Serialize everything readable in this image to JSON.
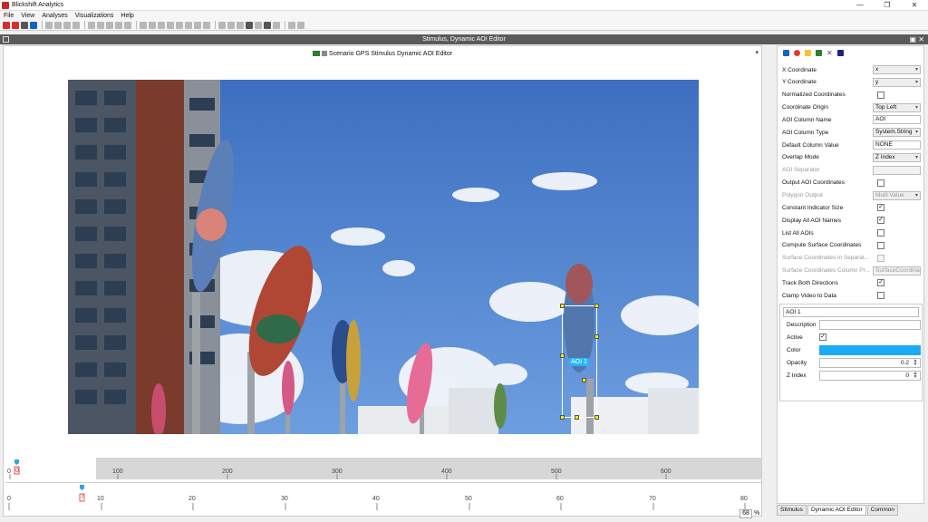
{
  "window": {
    "title": "Blickshift Analytics",
    "controls": [
      "—",
      "❐",
      "✕"
    ]
  },
  "menu": [
    "File",
    "View",
    "Analyses",
    "Visualizations",
    "Help"
  ],
  "panel": {
    "title": "Stimulus, Dynamic AOI Editor"
  },
  "stimulus": {
    "header": "Scenario GPS Stimulus Dynamic AOI Editor",
    "aoi_label": "AOI 1"
  },
  "timeline": {
    "top_ticks": [
      "0",
      "100",
      "200",
      "300",
      "400",
      "500",
      "600"
    ],
    "bottom_ticks": [
      "0",
      "10",
      "20",
      "30",
      "40",
      "50",
      "60",
      "70",
      "80"
    ],
    "top_marker": "0",
    "bottom_marker": "7"
  },
  "zoom": {
    "value": "68",
    "unit": "%"
  },
  "properties": [
    {
      "label": "X Coordinate",
      "type": "select",
      "value": "x"
    },
    {
      "label": "Y Coordinate",
      "type": "select",
      "value": "y"
    },
    {
      "label": "Normalized Coordinates",
      "type": "check",
      "checked": false
    },
    {
      "label": "Coordinate Origin",
      "type": "select",
      "value": "Top Left"
    },
    {
      "label": "AOI Column Name",
      "type": "text",
      "value": "AOI"
    },
    {
      "label": "AOI Column Type",
      "type": "select",
      "value": "System.String"
    },
    {
      "label": "Default Column Value",
      "type": "text",
      "value": "NONE"
    },
    {
      "label": "Overlap Mode",
      "type": "select",
      "value": "Z Index"
    },
    {
      "label": "AOI Separator",
      "type": "text",
      "value": "",
      "disabled": true
    },
    {
      "label": "Output AOI Coordinates",
      "type": "check",
      "checked": false
    },
    {
      "label": "Polygon Output",
      "type": "select",
      "value": "Multi Value",
      "disabled": true
    },
    {
      "label": "Constant Indicator Size",
      "type": "check",
      "checked": true
    },
    {
      "label": "Display All AOI Names",
      "type": "check",
      "checked": true
    },
    {
      "label": "List All AOIs",
      "type": "check",
      "checked": false
    },
    {
      "label": "Compute Surface Coordinates",
      "type": "check",
      "checked": false
    },
    {
      "label": "Surface Coordinates in Separat...",
      "type": "check",
      "checked": false,
      "disabled": true
    },
    {
      "label": "Surface Coordinates Column Pr...",
      "type": "text",
      "value": "SurfaceCoordinate",
      "disabled": true
    },
    {
      "label": "Track Both Directions",
      "type": "check",
      "checked": true
    },
    {
      "label": "Clamp Video to Data",
      "type": "check",
      "checked": false
    }
  ],
  "aoi": {
    "name": "AOI 1",
    "description_label": "Description",
    "description": "",
    "active_label": "Active",
    "active": true,
    "color_label": "Color",
    "color": "#1aabf5",
    "opacity_label": "Opacity",
    "opacity": "0.2",
    "zindex_label": "Z Index",
    "zindex": "0"
  },
  "tabs": [
    "Stimulus",
    "Dynamic AOI Editor",
    "Common"
  ],
  "colors": {
    "panel_header": "#5a5a5a",
    "accent": "#1aabf5",
    "handle": "#ffeb00"
  }
}
